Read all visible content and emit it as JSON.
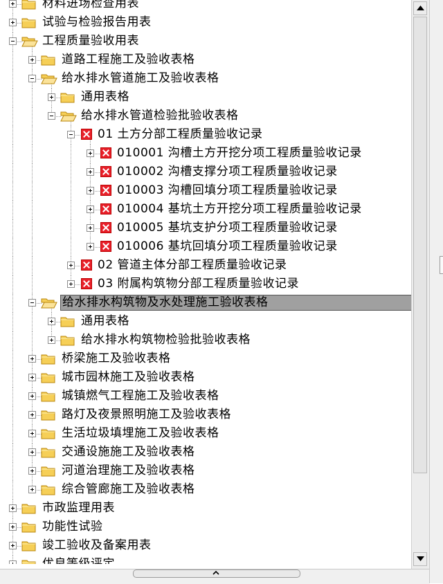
{
  "tree": {
    "rows": [
      {
        "label": "材料进场检查用表",
        "type": "folder",
        "expander": "plus",
        "depth": 0,
        "open": false
      },
      {
        "label": "试验与检验报告用表",
        "type": "folder",
        "expander": "plus",
        "depth": 0,
        "open": false
      },
      {
        "label": "工程质量验收用表",
        "type": "folder",
        "expander": "minus",
        "depth": 0,
        "open": true
      },
      {
        "label": "道路工程施工及验收表格",
        "type": "folder",
        "expander": "plus",
        "depth": 1,
        "open": false
      },
      {
        "label": "给水排水管道施工及验收表格",
        "type": "folder",
        "expander": "minus",
        "depth": 1,
        "open": true
      },
      {
        "label": "通用表格",
        "type": "folder",
        "expander": "plus",
        "depth": 2,
        "open": false
      },
      {
        "label": "给水排水管道检验批验收表格",
        "type": "folder",
        "expander": "minus",
        "depth": 2,
        "open": true
      },
      {
        "label": "01 土方分部工程质量验收记录",
        "type": "record",
        "expander": "minus",
        "depth": 3
      },
      {
        "label": "010001 沟槽土方开挖分项工程质量验收记录",
        "type": "record",
        "expander": "plus",
        "depth": 4
      },
      {
        "label": "010002 沟槽支撑分项工程质量验收记录",
        "type": "record",
        "expander": "plus",
        "depth": 4
      },
      {
        "label": "010003 沟槽回填分项工程质量验收记录",
        "type": "record",
        "expander": "plus",
        "depth": 4
      },
      {
        "label": "010004 基坑土方开挖分项工程质量验收记录",
        "type": "record",
        "expander": "plus",
        "depth": 4
      },
      {
        "label": "010005 基坑支护分项工程质量验收记录",
        "type": "record",
        "expander": "plus",
        "depth": 4
      },
      {
        "label": "010006 基坑回填分项工程质量验收记录",
        "type": "record",
        "expander": "plus",
        "depth": 4
      },
      {
        "label": "02 管道主体分部工程质量验收记录",
        "type": "record",
        "expander": "plus",
        "depth": 3
      },
      {
        "label": "03 附属构筑物分部工程质量验收记录",
        "type": "record",
        "expander": "plus",
        "depth": 3
      },
      {
        "label": "给水排水构筑物及水处理施工验收表格",
        "type": "folder",
        "expander": "minus",
        "depth": 1,
        "open": true,
        "selected": true
      },
      {
        "label": "通用表格",
        "type": "folder",
        "expander": "plus",
        "depth": 2,
        "open": false
      },
      {
        "label": "给水排水构筑物检验批验收表格",
        "type": "folder",
        "expander": "plus",
        "depth": 2,
        "open": false
      },
      {
        "label": "桥梁施工及验收表格",
        "type": "folder",
        "expander": "plus",
        "depth": 1,
        "open": false
      },
      {
        "label": "城市园林施工及验收表格",
        "type": "folder",
        "expander": "plus",
        "depth": 1,
        "open": false
      },
      {
        "label": "城镇燃气工程施工及验收表格",
        "type": "folder",
        "expander": "plus",
        "depth": 1,
        "open": false
      },
      {
        "label": "路灯及夜景照明施工及验收表格",
        "type": "folder",
        "expander": "plus",
        "depth": 1,
        "open": false
      },
      {
        "label": "生活垃圾填埋施工及验收表格",
        "type": "folder",
        "expander": "plus",
        "depth": 1,
        "open": false
      },
      {
        "label": "交通设施施工及验收表格",
        "type": "folder",
        "expander": "plus",
        "depth": 1,
        "open": false
      },
      {
        "label": "河道治理施工及验收表格",
        "type": "folder",
        "expander": "plus",
        "depth": 1,
        "open": false
      },
      {
        "label": "综合管廊施工及验收表格",
        "type": "folder",
        "expander": "plus",
        "depth": 1,
        "open": false
      },
      {
        "label": "市政监理用表",
        "type": "folder",
        "expander": "plus",
        "depth": 0,
        "open": false
      },
      {
        "label": "功能性试验",
        "type": "folder",
        "expander": "plus",
        "depth": 0,
        "open": false
      },
      {
        "label": "竣工验收及备案用表",
        "type": "folder",
        "expander": "plus",
        "depth": 0,
        "open": false
      },
      {
        "label": "优良等级评定",
        "type": "folder",
        "expander": "plus",
        "depth": 0,
        "open": false
      }
    ]
  },
  "scrollbar": {
    "up_icon": "arrow-up-icon",
    "down_icon": "arrow-down-icon"
  },
  "colors": {
    "selected_bg": "#a0a0a0",
    "folder": "#f5c542",
    "record_icon": "#e8202a"
  }
}
